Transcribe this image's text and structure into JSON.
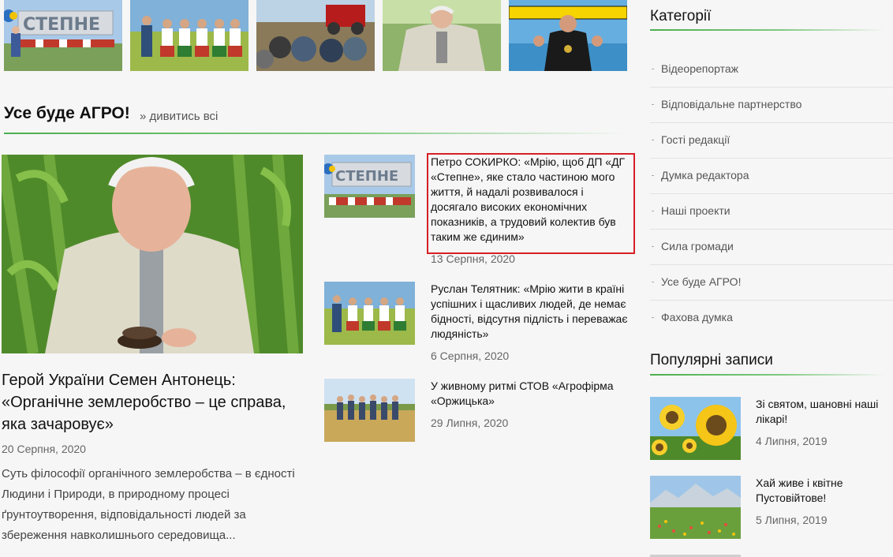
{
  "top_gallery": [
    {
      "alt": "Степне"
    },
    {
      "alt": "Фольклорний колектив"
    },
    {
      "alt": "Техніка в полі"
    },
    {
      "alt": "Петро Сокирко"
    },
    {
      "alt": "Спортсмен"
    }
  ],
  "section": {
    "title": "Усе буде АГРО!",
    "more_link": "» дивитись всі"
  },
  "featured": {
    "title": "Герой України Семен Антонець: «Органічне землеробство – це справа, яка зачаровує»",
    "date": "20 Серпня, 2020",
    "excerpt": "Суть філософії органічного землеробства – в єдності Людини і Природи, в природному процесі ґрунтоутворення, відповідальності людей за збереження навколишнього середовища..."
  },
  "articles": [
    {
      "title": "Петро СОКИРКО: «Мрію, щоб ДП «ДГ «Степне», яке стало частиною мого життя, й надалі розвивалося і досягало високих економічних показників, а трудовий колектив був таким же єдиним»",
      "date": "13 Серпня, 2020"
    },
    {
      "title": "Руслан Телятник: «Мрію жити в країні успішних і щасливих людей, де немає бідності, відсутня підлість і переважає людяність»",
      "date": "6 Серпня, 2020"
    },
    {
      "title": "У живному ритмі СТОВ «Агрофірма «Оржицька»",
      "date": "29 Липня, 2020"
    }
  ],
  "sidebar": {
    "categories_title": "Категорії",
    "categories": [
      "Відеорепортаж",
      "Відповідальне партнерство",
      "Гості редакції",
      "Думка редактора",
      "Наші проекти",
      "Сила громади",
      "Усе буде АГРО!",
      "Фахова думка"
    ],
    "popular_title": "Популярні записи",
    "popular": [
      {
        "title": "Зі святом, шановні наші лікарі!",
        "date": "4 Липня, 2019"
      },
      {
        "title": "Хай живе і квітне Пустовійтове!",
        "date": "5 Липня, 2019"
      }
    ]
  },
  "colors": {
    "accent_green": "#4caf50",
    "highlight_red": "#d61f26"
  }
}
